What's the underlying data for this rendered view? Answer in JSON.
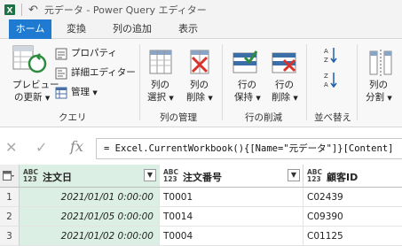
{
  "window": {
    "title": "元データ - Power Query エディター"
  },
  "tabs": [
    {
      "label": "ホーム",
      "active": true
    },
    {
      "label": "変換"
    },
    {
      "label": "列の追加"
    },
    {
      "label": "表示"
    }
  ],
  "ribbon": {
    "preview_refresh": {
      "line1": "プレビュー",
      "line2": "の更新"
    },
    "properties": "プロパティ",
    "advanced_editor": "詳細エディター",
    "manage": "管理",
    "query_group": "クエリ",
    "choose_columns": {
      "line1": "列の",
      "line2": "選択"
    },
    "remove_columns": {
      "line1": "列の",
      "line2": "削除"
    },
    "manage_columns_group": "列の管理",
    "keep_rows": {
      "line1": "行の",
      "line2": "保持"
    },
    "remove_rows": {
      "line1": "行の",
      "line2": "削除"
    },
    "reduce_rows_group": "行の削減",
    "sort_group": "並べ替え",
    "split_column": {
      "line1": "列の",
      "line2": "分割"
    }
  },
  "formula_bar": {
    "cancel_icon": "close-icon",
    "confirm_icon": "check-icon",
    "fx_label": "fx",
    "formula": "= Excel.CurrentWorkbook(){[Name=\"元データ\"]}[Content]"
  },
  "grid": {
    "type_badge": {
      "line1": "ABC",
      "line2": "123"
    },
    "columns": [
      {
        "name": "注文日"
      },
      {
        "name": "注文番号"
      },
      {
        "name": "顧客ID"
      }
    ],
    "rows": [
      {
        "num": "1",
        "cells": [
          "2021/01/01 0:00:00",
          "T0001",
          "C02439"
        ]
      },
      {
        "num": "2",
        "cells": [
          "2021/01/05 0:00:00",
          "T0014",
          "C09390"
        ]
      },
      {
        "num": "3",
        "cells": [
          "2021/01/02 0:00:00",
          "T0004",
          "C01125"
        ]
      }
    ]
  },
  "colors": {
    "accent": "#1f7ad1",
    "selected_column": "#dcefe4",
    "window_bg": "#f3f3f3"
  }
}
